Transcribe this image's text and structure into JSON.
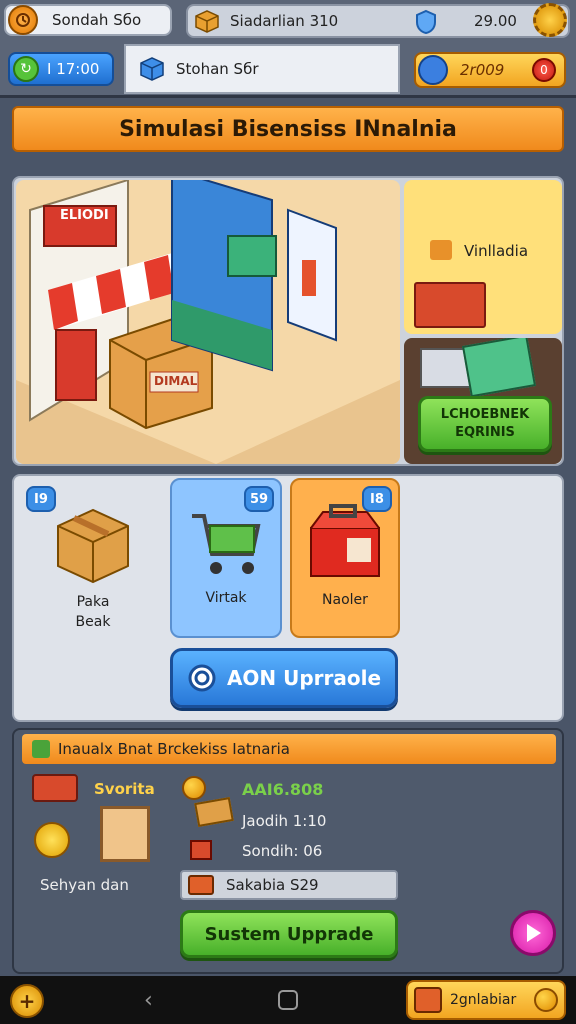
{
  "topbar": {
    "player_name": "Sondah Sбo",
    "warehouse_label": "Siadarlian 310",
    "money": "29.00",
    "timer": "I 17:00",
    "store_label": "Stohan Sбr",
    "gems": "2r009"
  },
  "banner": {
    "title": "Simulasi Bisensiss INnalnia"
  },
  "scene": {
    "sign_text": "ELIODI",
    "crate_label": "DIMAL",
    "side_label": "Vinlladia",
    "side_button": "LCHOEBNEK\nEQRINIS"
  },
  "items": [
    {
      "badge": "I9",
      "label": "Paka\nBeak"
    },
    {
      "badge": "59",
      "label": "Virtak"
    },
    {
      "badge": "I8",
      "label": "Naoler"
    }
  ],
  "upgrade_button": "AON Uprraole",
  "stats": {
    "header": "Inaualx Bnat Brckekiss Iatnaria",
    "vehicle_label": "Svorita",
    "staff_label": "Sehyan dan",
    "income": "AAI6.808",
    "line2": "Jaodih 1:10",
    "line3": "Sondih: 06",
    "status_bar": "Sakabia S29",
    "system_button": "Sustem Upprade"
  },
  "navbar": {
    "wallet": "2gnlabiar"
  },
  "colors": {
    "accent_orange": "#f08a1c",
    "blue_card": "#8ec5ff",
    "orange_card": "#ffb04d",
    "green_button": "#48b02a"
  }
}
